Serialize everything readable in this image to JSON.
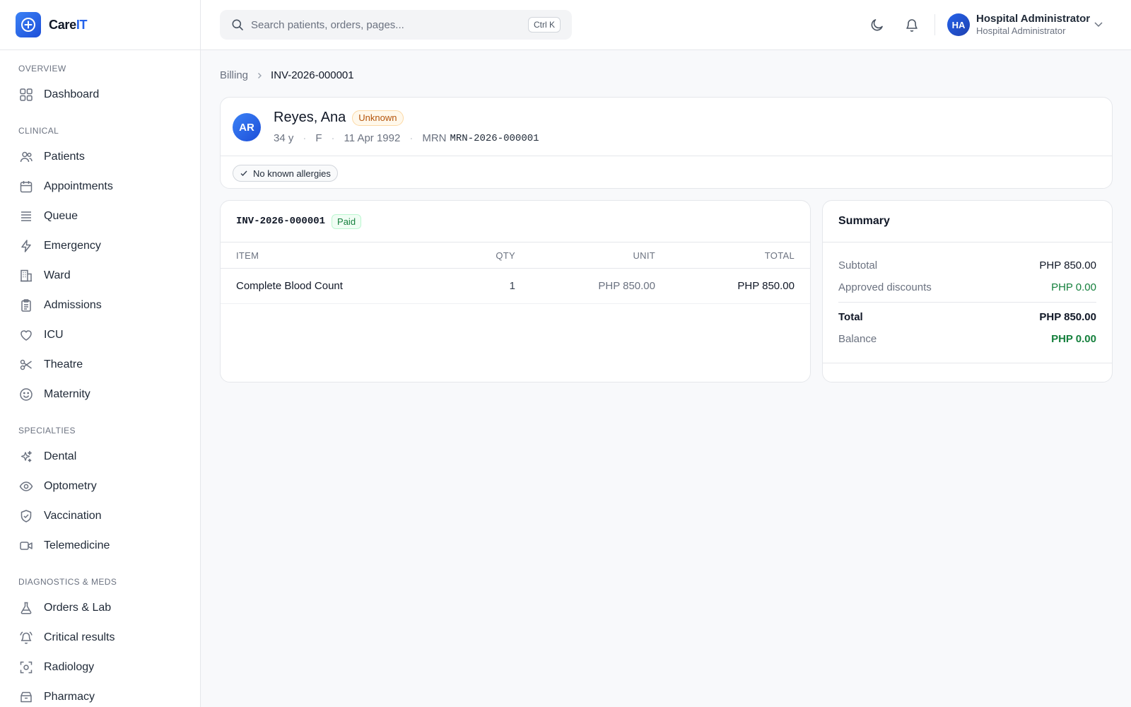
{
  "brand": {
    "name_prefix": "Care",
    "name_accent": "IT",
    "logo_icon": "plus-circle-icon"
  },
  "header": {
    "search": {
      "placeholder": "Search patients, orders, pages...",
      "shortcut": "Ctrl K"
    },
    "user": {
      "initials": "HA",
      "name": "Hospital Administrator",
      "role": "Hospital Administrator"
    }
  },
  "sidebar": {
    "sections": [
      {
        "title": "OVERVIEW",
        "items": [
          {
            "label": "Dashboard",
            "icon": "grid-icon"
          }
        ]
      },
      {
        "title": "CLINICAL",
        "items": [
          {
            "label": "Patients",
            "icon": "users-icon"
          },
          {
            "label": "Appointments",
            "icon": "calendar-icon"
          },
          {
            "label": "Queue",
            "icon": "list-icon"
          },
          {
            "label": "Emergency",
            "icon": "bolt-icon"
          },
          {
            "label": "Ward",
            "icon": "building-icon"
          },
          {
            "label": "Admissions",
            "icon": "clipboard-icon"
          },
          {
            "label": "ICU",
            "icon": "heart-icon"
          },
          {
            "label": "Theatre",
            "icon": "scissors-icon"
          },
          {
            "label": "Maternity",
            "icon": "smile-icon"
          }
        ]
      },
      {
        "title": "SPECIALTIES",
        "items": [
          {
            "label": "Dental",
            "icon": "sparkles-icon"
          },
          {
            "label": "Optometry",
            "icon": "eye-icon"
          },
          {
            "label": "Vaccination",
            "icon": "shield-check-icon"
          },
          {
            "label": "Telemedicine",
            "icon": "video-icon"
          }
        ]
      },
      {
        "title": "DIAGNOSTICS & MEDS",
        "items": [
          {
            "label": "Orders & Lab",
            "icon": "flask-icon"
          },
          {
            "label": "Critical results",
            "icon": "bell-ring-icon"
          },
          {
            "label": "Radiology",
            "icon": "scan-icon"
          },
          {
            "label": "Pharmacy",
            "icon": "pill-box-icon"
          }
        ]
      }
    ]
  },
  "breadcrumb": {
    "parent": "Billing",
    "current": "INV-2026-000001"
  },
  "patient": {
    "initials": "AR",
    "name": "Reyes, Ana",
    "status": "Unknown",
    "age": "34 y",
    "sex": "F",
    "dob": "11 Apr 1992",
    "mrn_label": "MRN",
    "mrn": "MRN-2026-000001",
    "allergy": "No known allergies"
  },
  "invoice": {
    "number": "INV-2026-000001",
    "status": "Paid",
    "columns": {
      "item": "ITEM",
      "qty": "QTY",
      "unit": "UNIT",
      "total": "TOTAL"
    },
    "rows": [
      {
        "item": "Complete Blood Count",
        "qty": "1",
        "unit": "PHP 850.00",
        "total": "PHP 850.00"
      }
    ]
  },
  "summary": {
    "title": "Summary",
    "subtotal_label": "Subtotal",
    "subtotal": "PHP 850.00",
    "discounts_label": "Approved discounts",
    "discounts": "PHP 0.00",
    "total_label": "Total",
    "total": "PHP 850.00",
    "balance_label": "Balance",
    "balance": "PHP 0.00"
  },
  "colors": {
    "accent": "#2563eb",
    "paid_green": "#15803d",
    "warning_amber": "#b45309"
  }
}
